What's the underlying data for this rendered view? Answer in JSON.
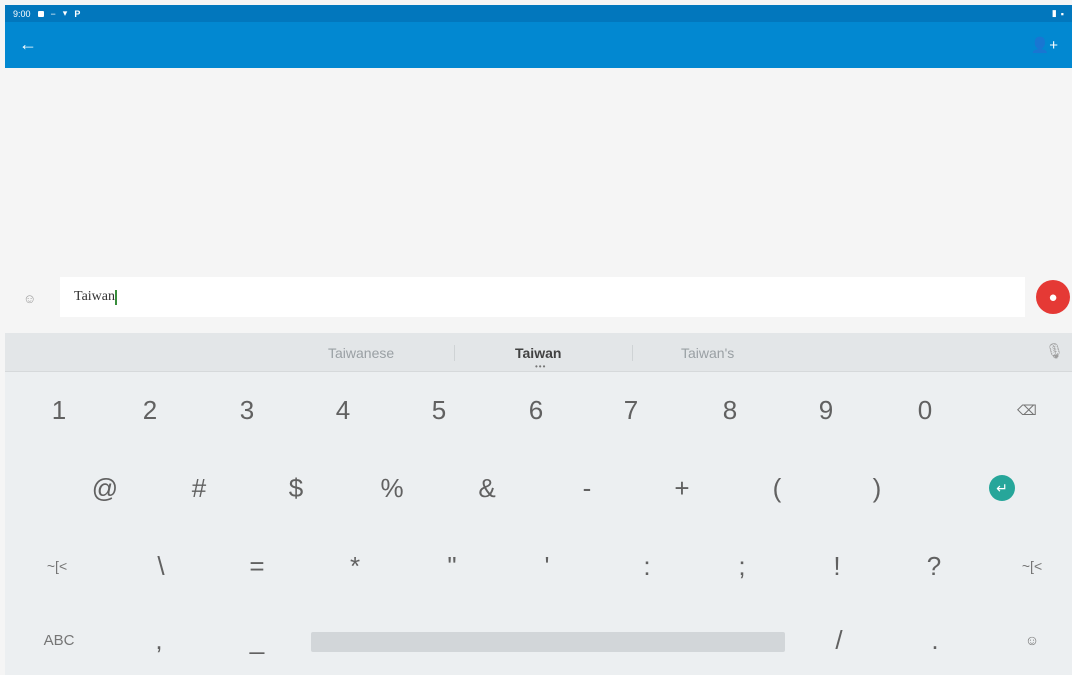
{
  "status_bar": {
    "time": "9:00",
    "icons_left": [
      "notification-icon",
      "minus-icon",
      "download-icon",
      "p-icon"
    ],
    "icons_right": [
      "battery-icon",
      "signal-icon"
    ]
  },
  "app_bar": {
    "back_icon": "arrow-left-icon",
    "title": "",
    "action_icon": "add-person-icon"
  },
  "compose": {
    "icon": "emoji-icon",
    "value": "Taiwan",
    "send_icon": "person-icon",
    "send_color": "#e53935"
  },
  "keyboard": {
    "suggestions": [
      "Taiwanese",
      "Taiwan",
      "Taiwan's"
    ],
    "suggestion_dots": "•••",
    "mic_icon": "mic-icon",
    "row1": [
      "1",
      "2",
      "3",
      "4",
      "5",
      "6",
      "7",
      "8",
      "9",
      "0"
    ],
    "row1_backspace_icon": "backspace-icon",
    "row2": [
      "@",
      "#",
      "$",
      "%",
      "&",
      "-",
      "+",
      "(",
      ")"
    ],
    "enter_icon": "enter-icon",
    "enter_color": "#26a69a",
    "row3_shift_left": "~[<",
    "row3": [
      "\\",
      "=",
      "*",
      "\"",
      "'",
      ":",
      ";",
      "!",
      "?"
    ],
    "row3_shift_right": "~[<",
    "row4_abc": "ABC",
    "row4_comma": ",",
    "row4_underscore": "_",
    "row4_slash": "/",
    "row4_period": ".",
    "emoji_icon": "emoji-icon"
  },
  "colors": {
    "app_bar": "#0288d1",
    "status_bar": "#0277bd",
    "keyboard_bg": "#eceff1"
  }
}
